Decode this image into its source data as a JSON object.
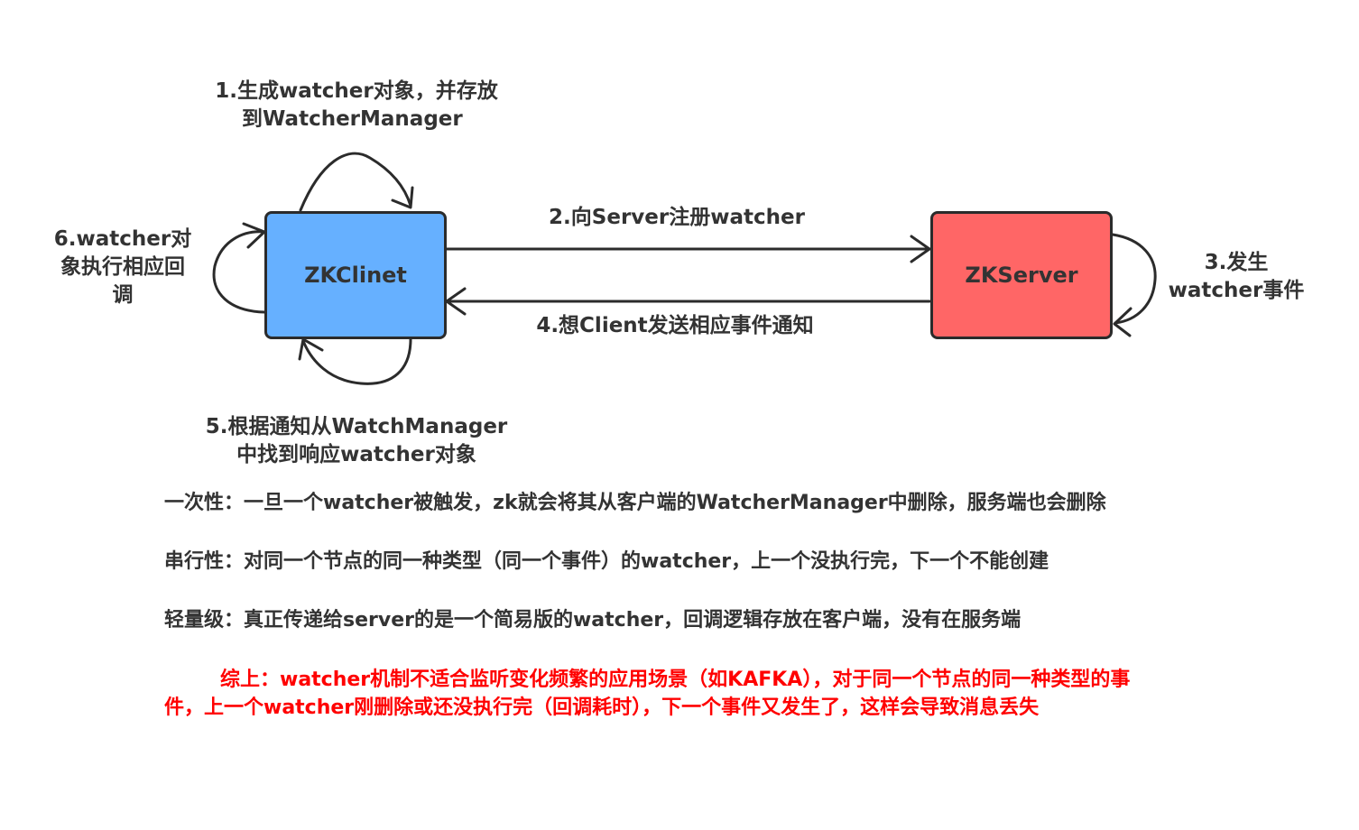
{
  "nodes": {
    "client": {
      "label": "ZKClinet",
      "color": "#66b0ff"
    },
    "server": {
      "label": "ZKServer",
      "color": "#ff6666"
    }
  },
  "steps": {
    "step1": {
      "line1": "1.生成watcher对象，并存放",
      "line2": "到WatcherManager"
    },
    "step2": {
      "text": "2.向Server注册watcher"
    },
    "step3": {
      "line1": "3.发生",
      "line2": "watcher事件"
    },
    "step4": {
      "text": "4.想Client发送相应事件通知"
    },
    "step5": {
      "line1": "5.根据通知从WatchManager",
      "line2": "中找到响应watcher对象"
    },
    "step6": {
      "line1": "6.watcher对",
      "line2": "象执行相应回",
      "line3": "调"
    }
  },
  "notes": {
    "one_time": "一次性：一旦一个watcher被触发，zk就会将其从客户端的WatcherManager中删除，服务端也会删除",
    "serial": "串行性：对同一个节点的同一种类型（同一个事件）的watcher，上一个没执行完，下一个不能创建",
    "lightweight": "轻量级：真正传递给server的是一个简易版的watcher，回调逻辑存放在客户端，没有在服务端"
  },
  "summary": {
    "line1": "综上：watcher机制不适合监听变化频繁的应用场景（如KAFKA），对于同一个节点的同一种类型的事",
    "line2": "件，上一个watcher刚删除或还没执行完（回调耗时），下一个事件又发生了，这样会导致消息丢失",
    "color": "#ff0000"
  },
  "colors": {
    "line": "#2b2b2b",
    "text": "#333333"
  }
}
